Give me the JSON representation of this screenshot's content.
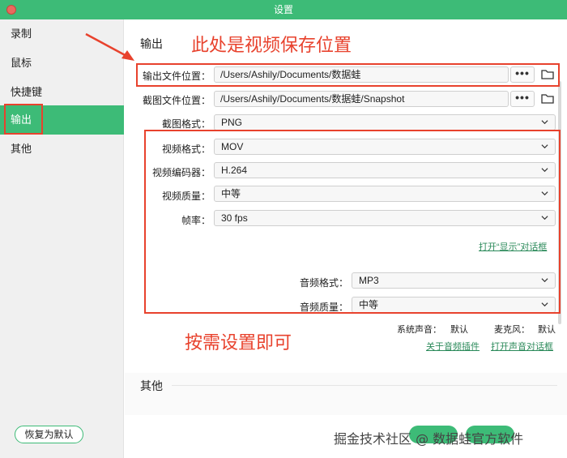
{
  "window": {
    "title": "设置"
  },
  "sidebar": {
    "items": [
      {
        "label": "录制"
      },
      {
        "label": "鼠标"
      },
      {
        "label": "快捷键"
      },
      {
        "label": "输出"
      },
      {
        "label": "其他"
      }
    ],
    "reset_label": "恢复为默认"
  },
  "output": {
    "section_title": "输出",
    "output_location": {
      "label": "输出文件位置：",
      "value": "/Users/Ashily/Documents/数据蛙"
    },
    "screenshot_location": {
      "label": "截图文件位置：",
      "value": "/Users/Ashily/Documents/数据蛙/Snapshot"
    },
    "screenshot_format": {
      "label": "截图格式：",
      "value": "PNG"
    },
    "video_format": {
      "label": "视频格式：",
      "value": "MOV"
    },
    "video_encoder": {
      "label": "视频编码器：",
      "value": "H.264"
    },
    "video_quality": {
      "label": "视频质量：",
      "value": "中等"
    },
    "frame_rate": {
      "label": "帧率：",
      "value": "30 fps"
    },
    "open_display_dialog": "打开“显示”对话框",
    "audio_format": {
      "label": "音频格式：",
      "value": "MP3"
    },
    "audio_quality": {
      "label": "音频质量：",
      "value": "中等"
    },
    "system_sound": {
      "label": "系统声音：",
      "value": "默认"
    },
    "microphone": {
      "label": "麦克风：",
      "value": "默认"
    },
    "about_audio_plugin": "关于音频插件",
    "open_sound_dialog": "打开声音对话框",
    "ellipsis": "•••"
  },
  "other": {
    "section_title": "其他"
  },
  "annotations": {
    "save_location_note": "此处是视频保存位置",
    "settings_note": "按需设置即可"
  },
  "watermark": "掘金技术社区 @ 数据蛙官方软件",
  "colors": {
    "accent": "#3dbb77",
    "annotation": "#e8422d"
  }
}
